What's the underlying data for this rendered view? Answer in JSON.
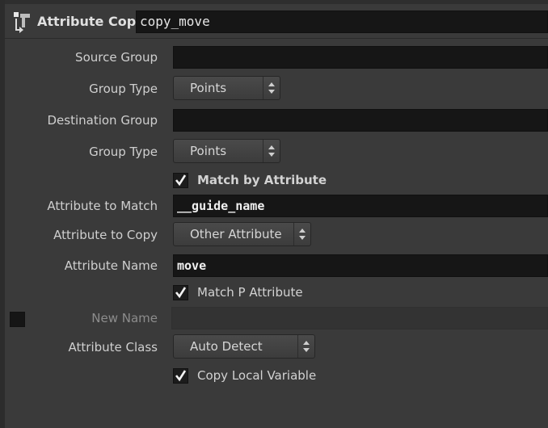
{
  "header": {
    "node_icon": "attribute-copy-node-icon",
    "node_type": "Attribute Copy",
    "node_name": "copy_move"
  },
  "params": {
    "source_group": {
      "label": "Source Group",
      "value": ""
    },
    "group_type_1": {
      "label": "Group Type",
      "value": "Points"
    },
    "destination_group": {
      "label": "Destination Group",
      "value": ""
    },
    "group_type_2": {
      "label": "Group Type",
      "value": "Points"
    },
    "match_by_attribute": {
      "label": "Match by Attribute",
      "checked": true
    },
    "attribute_to_match": {
      "label": "Attribute to Match",
      "value": "__guide_name"
    },
    "attribute_to_copy": {
      "label": "Attribute to Copy",
      "value": "Other Attribute"
    },
    "attribute_name": {
      "label": "Attribute Name",
      "value": "move"
    },
    "match_p_attribute": {
      "label": "Match P Attribute",
      "checked": true
    },
    "new_name": {
      "label": "New Name",
      "value": "",
      "enabled": false
    },
    "attribute_class": {
      "label": "Attribute Class",
      "value": "Auto Detect"
    },
    "copy_local_variable": {
      "label": "Copy Local Variable",
      "checked": true
    }
  },
  "colors": {
    "background": "#3a3a3a",
    "field": "#161616",
    "text": "#d2d2d2"
  }
}
